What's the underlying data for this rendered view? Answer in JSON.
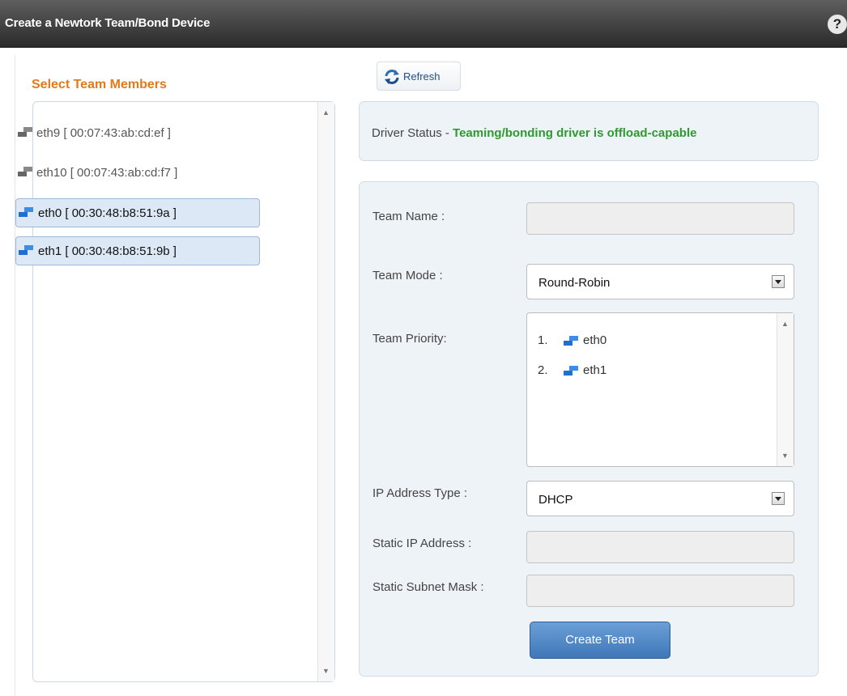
{
  "window": {
    "title": "Create a Newtork Team/Bond Device",
    "help_glyph": "?"
  },
  "toolbar": {
    "refresh_label": "Refresh"
  },
  "members": {
    "heading": "Select Team Members",
    "items": [
      {
        "label": "eth9 [ 00:07:43:ab:cd:ef ]",
        "selected": false,
        "icon": "network-icon"
      },
      {
        "label": "eth10 [ 00:07:43:ab:cd:f7 ]",
        "selected": false,
        "icon": "network-icon"
      },
      {
        "label": "eth0 [ 00:30:48:b8:51:9a ]",
        "selected": true,
        "icon": "network-icon"
      },
      {
        "label": "eth1 [ 00:30:48:b8:51:9b ]",
        "selected": true,
        "icon": "network-icon"
      }
    ]
  },
  "status": {
    "label": "Driver Status - ",
    "value": "Teaming/bonding driver is offload-capable"
  },
  "form": {
    "team_name_label": "Team Name :",
    "team_name_value": "",
    "team_mode_label": "Team Mode :",
    "team_mode_value": "Round-Robin",
    "team_priority_label": "Team Priority:",
    "priority": [
      {
        "num": "1.",
        "label": "eth0"
      },
      {
        "num": "2.",
        "label": "eth1"
      }
    ],
    "ip_type_label": "IP Address Type :",
    "ip_type_value": "DHCP",
    "static_ip_label": "Static IP Address :",
    "static_ip_value": "",
    "static_mask_label": "Static Subnet Mask :",
    "static_mask_value": "",
    "create_label": "Create Team"
  },
  "colors": {
    "accent_orange": "#e07a1b",
    "status_green": "#2e9a2e",
    "button_blue": "#3f77b8"
  }
}
